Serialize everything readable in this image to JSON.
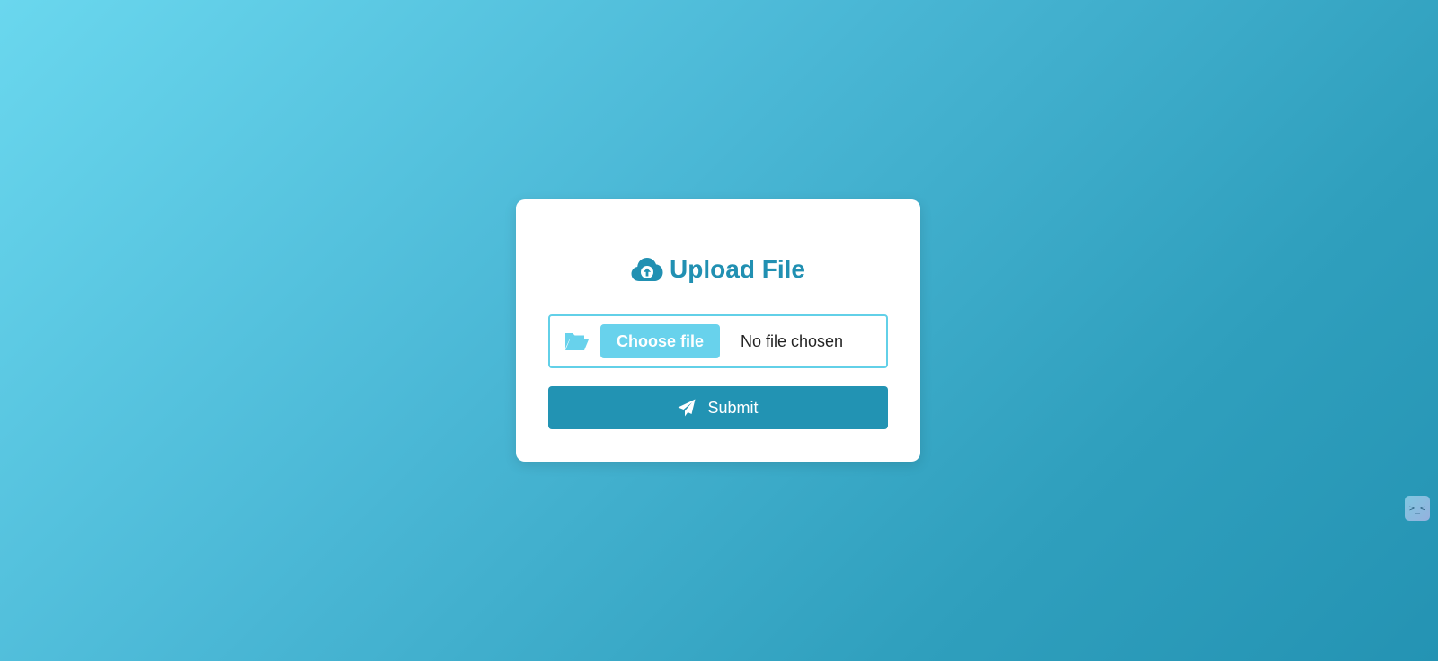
{
  "title": "Upload File",
  "file_input": {
    "button_label": "Choose file",
    "status": "No file chosen"
  },
  "submit": {
    "label": "Submit"
  },
  "icons": {
    "title": "cloud-upload-icon",
    "file": "folder-open-icon",
    "submit": "paper-plane-icon",
    "widget": "assistant-face-icon"
  },
  "colors": {
    "accent": "#2190b2",
    "file_button": "#68d2ec",
    "file_border": "#62d0e8",
    "background_start": "#6ad7ee",
    "background_end": "#2493b3"
  },
  "widget_glyph": ">_<"
}
